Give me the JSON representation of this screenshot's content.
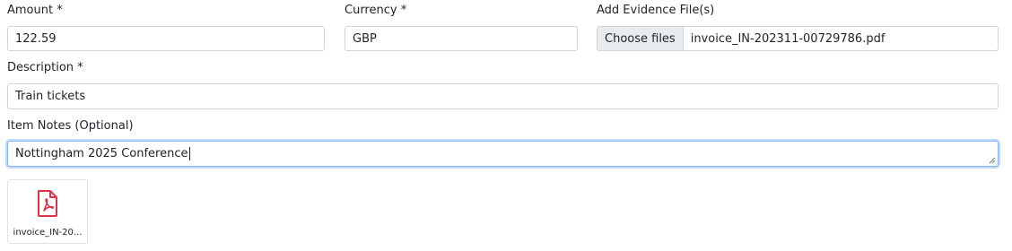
{
  "amount": {
    "label": "Amount *",
    "value": "122.59"
  },
  "currency": {
    "label": "Currency *",
    "value": "GBP"
  },
  "evidence": {
    "label": "Add Evidence File(s)",
    "button_label": "Choose files",
    "file_name": "invoice_IN-202311-00729786.pdf"
  },
  "description": {
    "label": "Description *",
    "value": "Train tickets"
  },
  "notes": {
    "label": "Item Notes (Optional)",
    "value": "Nottingham 2025 Conference"
  },
  "attachment": {
    "caption": "invoice_IN-20...",
    "icon": "pdf-file-icon",
    "icon_color": "#dc3545"
  }
}
